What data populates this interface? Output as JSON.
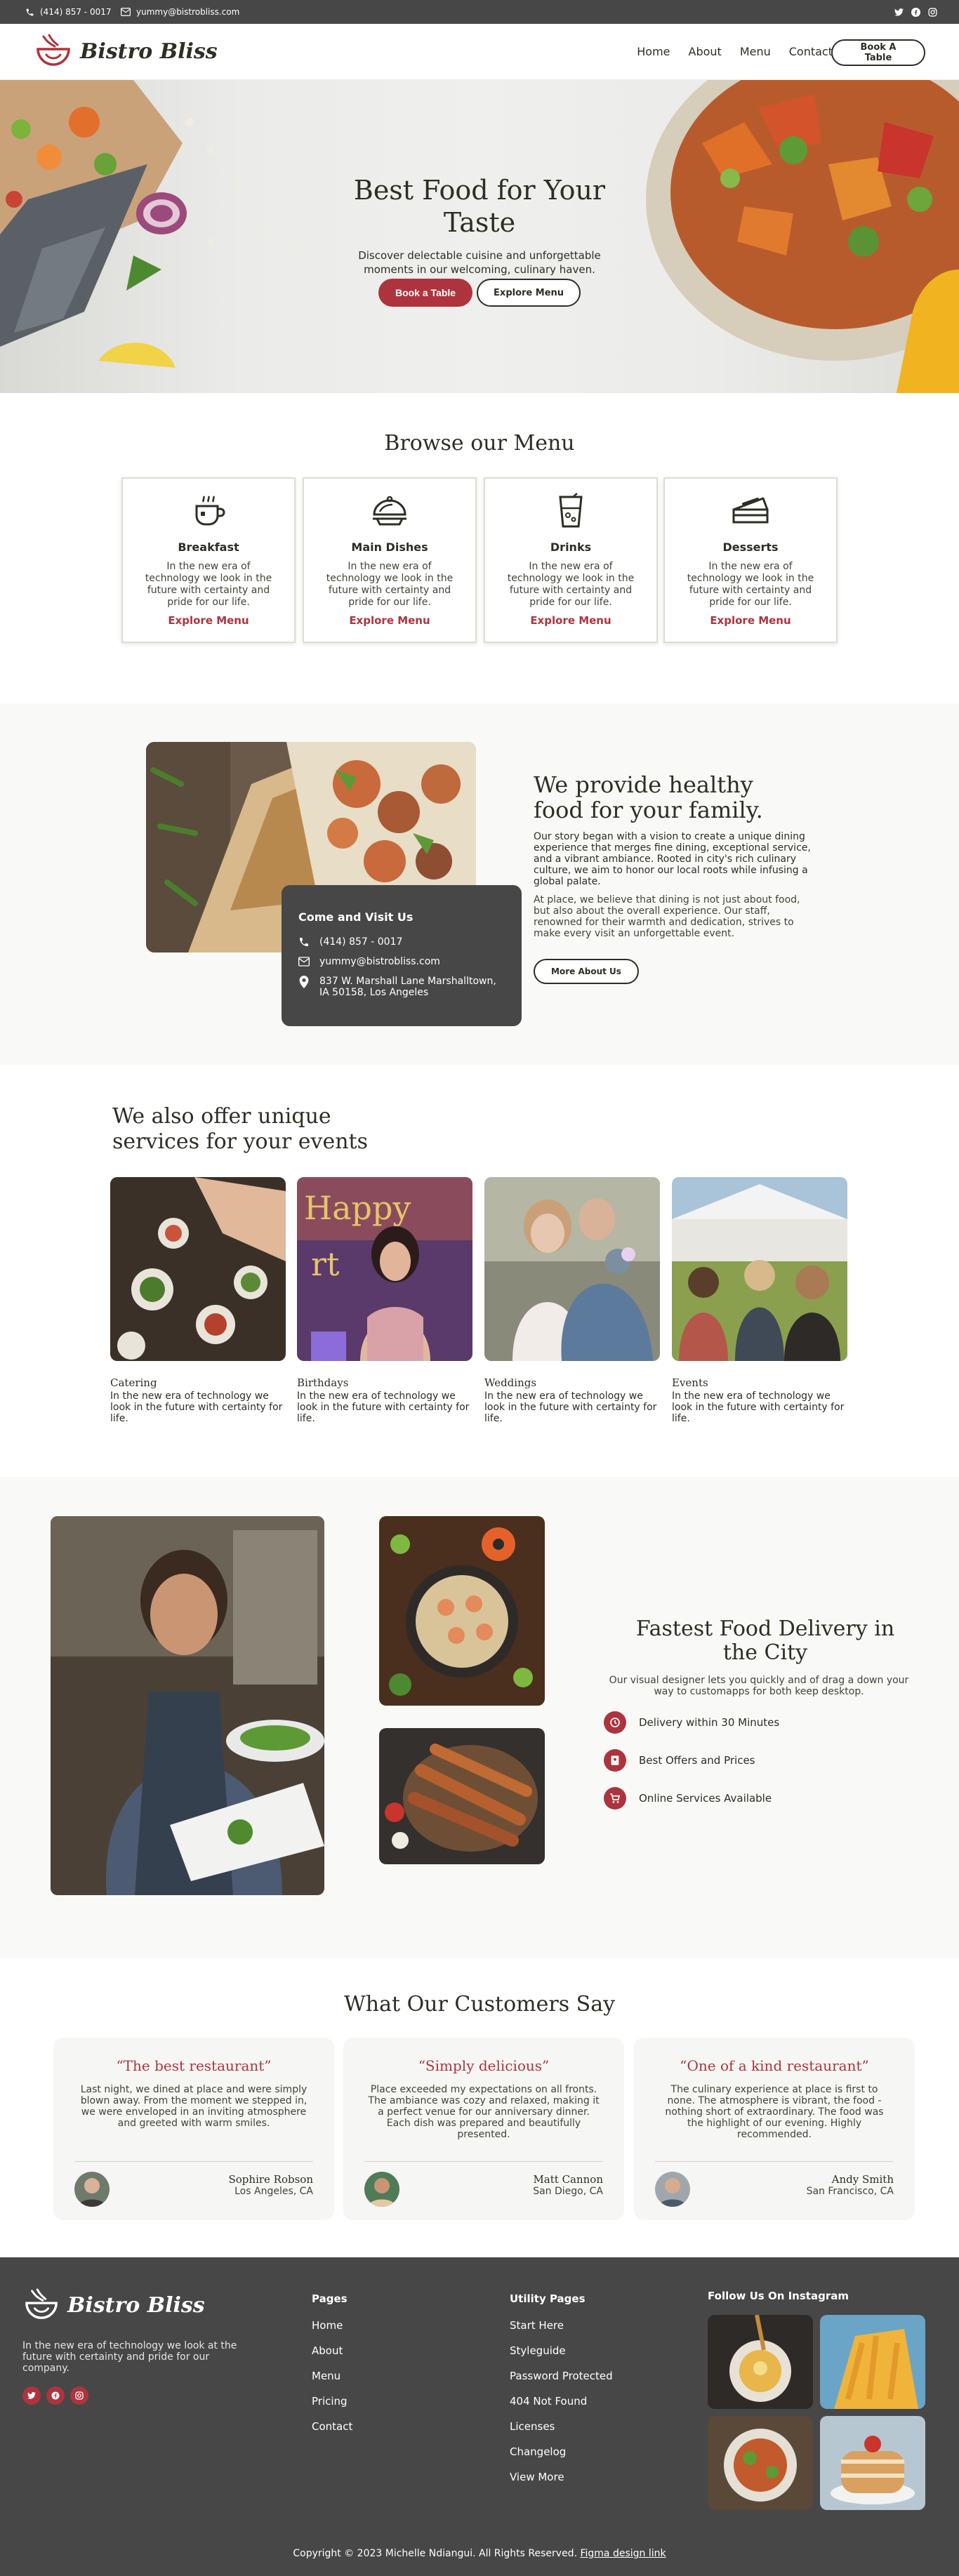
{
  "topbar": {
    "phone": "(414) 857 - 0017",
    "email": "yummy@bistrobliss.com",
    "social_icons": [
      "twitter-icon",
      "facebook-icon",
      "instagram-icon"
    ]
  },
  "brand": {
    "name": "Bistro Bliss",
    "accent_color": "#ad343e",
    "dark_color": "#474747",
    "text_color": "#2c2f24"
  },
  "nav": {
    "items": [
      "Home",
      "About",
      "Menu",
      "Contact"
    ],
    "cta": "Book A Table"
  },
  "hero": {
    "title": "Best Food for Your Taste",
    "subtitle": "Discover delectable cuisine and unforgettable moments in our welcoming, culinary haven.",
    "primary_button": "Book a Table",
    "secondary_button": "Explore Menu"
  },
  "menu_section": {
    "title": "Browse our Menu",
    "cards": [
      {
        "title": "Breakfast",
        "text": "In the new era of technology we look in the future with certainty and pride for our life.",
        "link": "Explore Menu",
        "icon": "coffee-cup-icon"
      },
      {
        "title": "Main Dishes",
        "text": "In the new era of technology we look in the future with certainty and pride for our life.",
        "link": "Explore Menu",
        "icon": "cloche-dish-icon"
      },
      {
        "title": "Drinks",
        "text": "In the new era of technology we look in the future with certainty and pride for our life.",
        "link": "Explore Menu",
        "icon": "drink-glass-icon"
      },
      {
        "title": "Desserts",
        "text": "In the new era of technology we look in the future with certainty and pride for our life.",
        "link": "Explore Menu",
        "icon": "cake-slice-icon"
      }
    ]
  },
  "about": {
    "title": "We provide healthy food for your family.",
    "paragraph1": "Our story began with a vision to create a unique dining experience that merges fine dining, exceptional service, and a vibrant ambiance. Rooted in city's rich culinary culture, we aim to honor our local roots while infusing a global palate.",
    "paragraph2": "At place, we believe that dining is not just about food, but also about the overall experience. Our staff, renowned for their warmth and dedication, strives to make every visit an unforgettable event.",
    "button": "More About Us",
    "contact_card": {
      "title": "Come and Visit Us",
      "phone": "(414) 857 - 0017",
      "email": "yummy@bistrobliss.com",
      "address": "837 W. Marshall Lane Marshalltown, IA 50158, Los Angeles"
    }
  },
  "services": {
    "title": "We also offer unique services for your events",
    "cards": [
      {
        "title": "Catering",
        "text": "In the new era of technology we look in the future with certainty for life."
      },
      {
        "title": "Birthdays",
        "text": "In the new era of technology we look in the future with certainty for life."
      },
      {
        "title": "Weddings",
        "text": "In the new era of technology we look in the future with certainty for life."
      },
      {
        "title": "Events",
        "text": "In the new era of technology we look in the future with certainty for life."
      }
    ]
  },
  "delivery": {
    "title": "Fastest Food Delivery in the City",
    "subtitle": "Our visual designer lets you quickly and of drag a down your way to customapps for both keep desktop.",
    "features": [
      {
        "label": "Delivery within 30 Minutes",
        "icon": "clock-icon"
      },
      {
        "label": "Best Offers and Prices",
        "icon": "tag-icon"
      },
      {
        "label": "Online Services Available",
        "icon": "cart-icon"
      }
    ]
  },
  "testimonials": {
    "title": "What Our Customers Say",
    "items": [
      {
        "headline": "“The best restaurant”",
        "text": "Last night, we dined at place and were simply blown away. From the moment we stepped in, we were enveloped in an inviting atmosphere and greeted with warm smiles.",
        "name": "Sophire Robson",
        "location": "Los Angeles, CA"
      },
      {
        "headline": "“Simply delicious”",
        "text": "Place exceeded my expectations on all fronts. The ambiance was cozy and relaxed, making it a perfect venue for our anniversary dinner. Each dish was prepared and beautifully presented.",
        "name": "Matt Cannon",
        "location": "San Diego, CA"
      },
      {
        "headline": "“One of a kind restaurant”",
        "text": "The culinary experience at place is first to none. The atmosphere is vibrant, the food - nothing short of extraordinary. The food was the highlight of our evening. Highly recommended.",
        "name": "Andy Smith",
        "location": "San Francisco, CA"
      }
    ]
  },
  "footer": {
    "tagline": "In the new era of technology we look at the future with certainty and pride for our company.",
    "pages_title": "Pages",
    "pages": [
      "Home",
      "About",
      "Menu",
      "Pricing",
      "Contact"
    ],
    "utility_title": "Utility Pages",
    "utility": [
      "Start Here",
      "Styleguide",
      "Password Protected",
      "404 Not Found",
      "Licenses",
      "Changelog",
      "View More"
    ],
    "instagram_title": "Follow Us On Instagram",
    "copyright": "Copyright © 2023 Michelle Ndiangui. All Rights Reserved.",
    "copyright_link": "Figma design link"
  }
}
